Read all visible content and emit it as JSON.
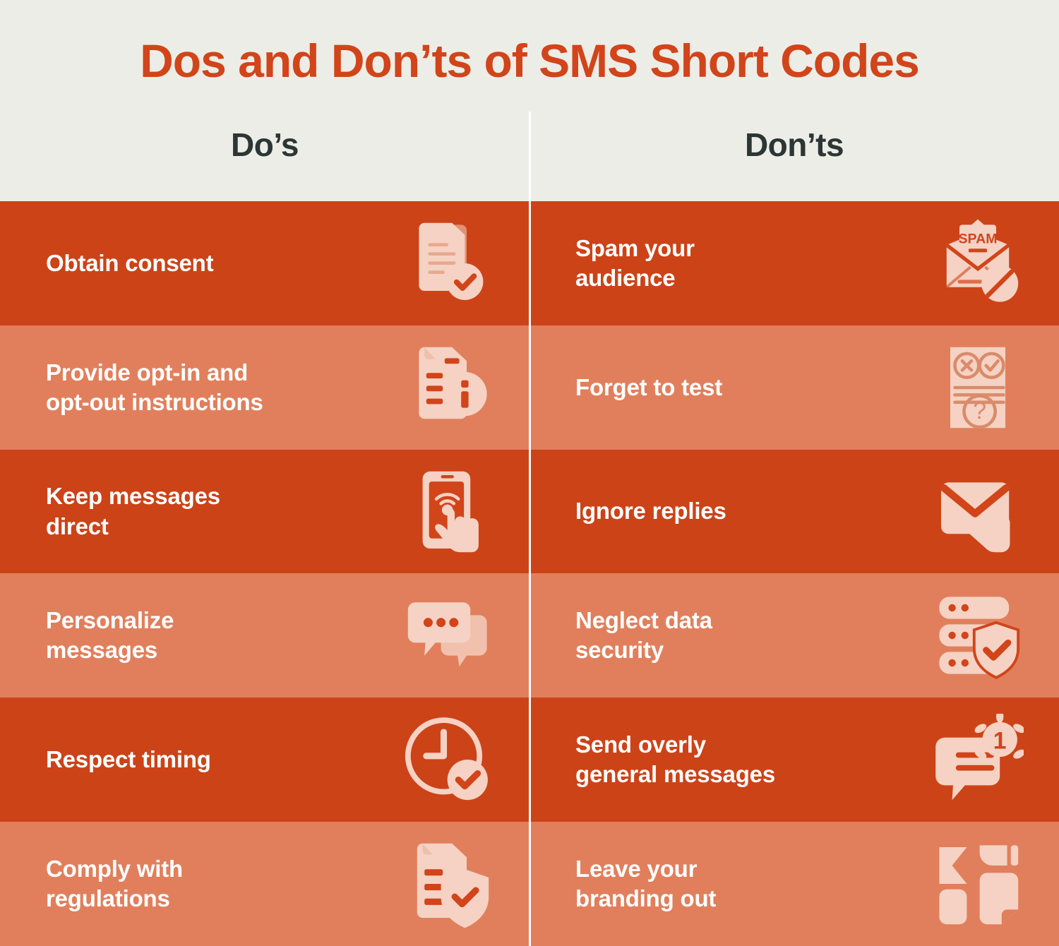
{
  "header": {
    "title": "Dos and Don’ts of SMS Short Codes",
    "columns": [
      {
        "label": "Do’s"
      },
      {
        "label": "Don’ts"
      }
    ]
  },
  "colors": {
    "background": "#EDEDE7",
    "title_orange": "#D2441A",
    "row_dark": "#CC4318",
    "row_light": "#E17F5C",
    "icon_fill": "#F5D2C3",
    "heading_dark": "#2B3635",
    "divider": "#FFFFFF",
    "label_text": "#FFFFFF"
  },
  "rows": [
    {
      "shade": "dark",
      "dos": {
        "label": "Obtain consent",
        "icon": "document-check-icon"
      },
      "donts": {
        "label": "Spam your\naudience",
        "icon": "spam-envelope-blocked-icon"
      }
    },
    {
      "shade": "light",
      "dos": {
        "label": "Provide opt-in and\nopt-out instructions",
        "icon": "document-info-icon"
      },
      "donts": {
        "label": "Forget to test",
        "icon": "test-sheet-question-icon"
      }
    },
    {
      "shade": "dark",
      "dos": {
        "label": "Keep messages\ndirect",
        "icon": "phone-tap-icon"
      },
      "donts": {
        "label": "Ignore replies",
        "icon": "envelope-reply-icon"
      }
    },
    {
      "shade": "light",
      "dos": {
        "label": "Personalize\nmessages",
        "icon": "chat-bubbles-icon"
      },
      "donts": {
        "label": "Neglect data\nsecurity",
        "icon": "server-shield-check-icon"
      }
    },
    {
      "shade": "dark",
      "dos": {
        "label": "Respect timing",
        "icon": "clock-check-icon"
      },
      "donts": {
        "label": "Send overly\ngeneral messages",
        "icon": "chat-notification-badge-icon"
      }
    },
    {
      "shade": "light",
      "dos": {
        "label": "Comply with\nregulations",
        "icon": "document-shield-check-icon"
      },
      "donts": {
        "label": "Leave your\nbranding out",
        "icon": "branding-mark-icon"
      }
    }
  ],
  "icon_badges": {
    "spam_text": "SPAM",
    "notification_count": "1"
  }
}
